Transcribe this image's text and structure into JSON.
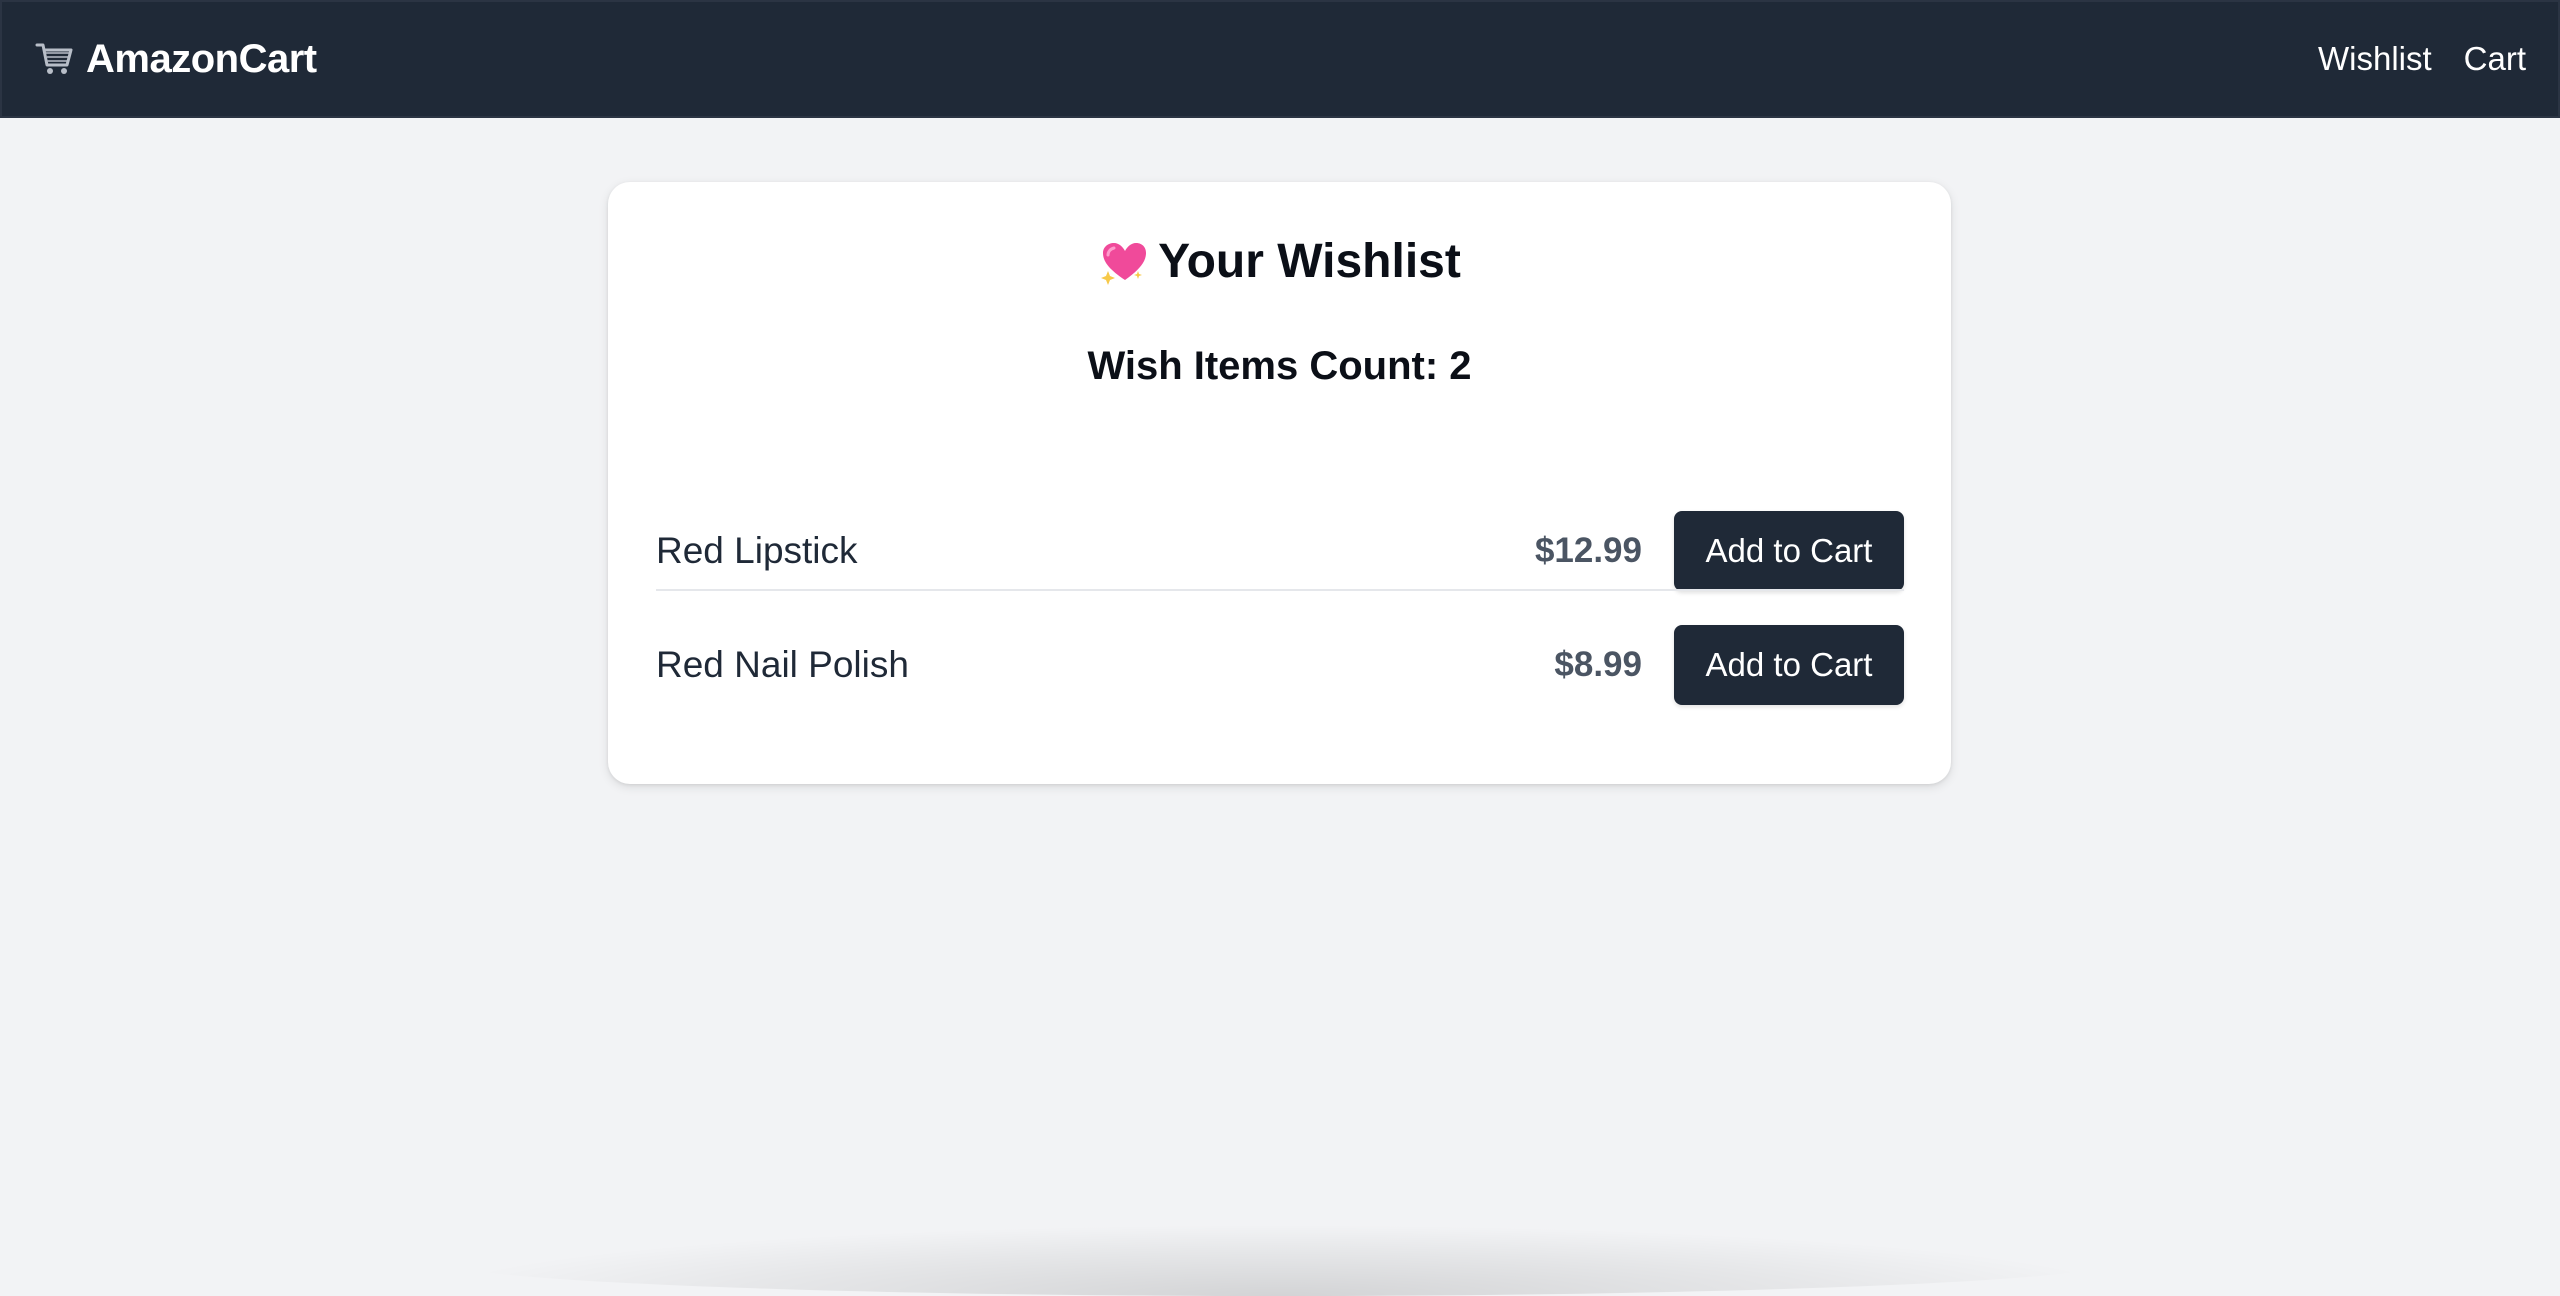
{
  "navbar": {
    "brand_icon": "shopping-cart-icon",
    "brand": "AmazonCart",
    "links": [
      "Wishlist",
      "Cart"
    ]
  },
  "wishlist": {
    "title_icon": "sparkling-heart-icon",
    "title": "Your Wishlist",
    "count_text": "Wish Items Count: 2",
    "items": [
      {
        "name": "Red Lipstick",
        "price": "$12.99",
        "button": "Add to Cart"
      },
      {
        "name": "Red Nail Polish",
        "price": "$8.99",
        "button": "Add to Cart"
      }
    ]
  },
  "colors": {
    "navbar_bg": "#1f2937",
    "page_bg": "#f2f3f5",
    "card_bg": "#ffffff",
    "button_bg": "#1f2937",
    "price_text": "#4b5563",
    "heart_pink": "#f04a9a"
  }
}
